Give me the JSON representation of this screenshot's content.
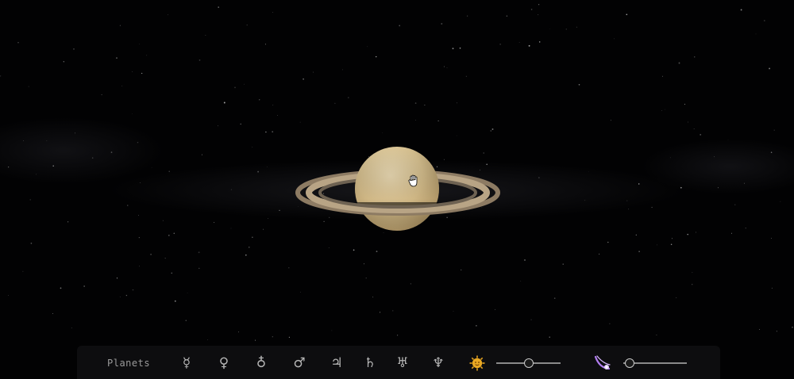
{
  "toolbar": {
    "label": "Planets",
    "planets": [
      {
        "name": "Mercury",
        "symbol": "☿",
        "icon": "mercury-icon"
      },
      {
        "name": "Venus",
        "symbol": "♀",
        "icon": "venus-icon"
      },
      {
        "name": "Earth",
        "symbol": "♁",
        "icon": "earth-icon"
      },
      {
        "name": "Mars",
        "symbol": "♂",
        "icon": "mars-icon"
      },
      {
        "name": "Jupiter",
        "symbol": "♃",
        "icon": "jupiter-icon"
      },
      {
        "name": "Saturn",
        "symbol": "♄",
        "icon": "saturn-icon"
      },
      {
        "name": "Uranus",
        "symbol": "♅",
        "icon": "uranus-icon"
      },
      {
        "name": "Neptune",
        "symbol": "♆",
        "icon": "neptune-icon"
      }
    ],
    "sun_icon": "sun-face-icon",
    "sun_slider_level": 0.5,
    "orbit_icon": "comet-orbit-icon",
    "orbit_slider_level": 0.1
  },
  "scene": {
    "selected_planet": "Saturn",
    "cursor_icon": "hand-cursor-icon"
  },
  "colors": {
    "background": "#020203",
    "toolbar_bg": "#0e0e10",
    "toolbar_text": "#9a9a9a",
    "sun": "#e0a020",
    "orbit_icon": "#b07cf0"
  }
}
